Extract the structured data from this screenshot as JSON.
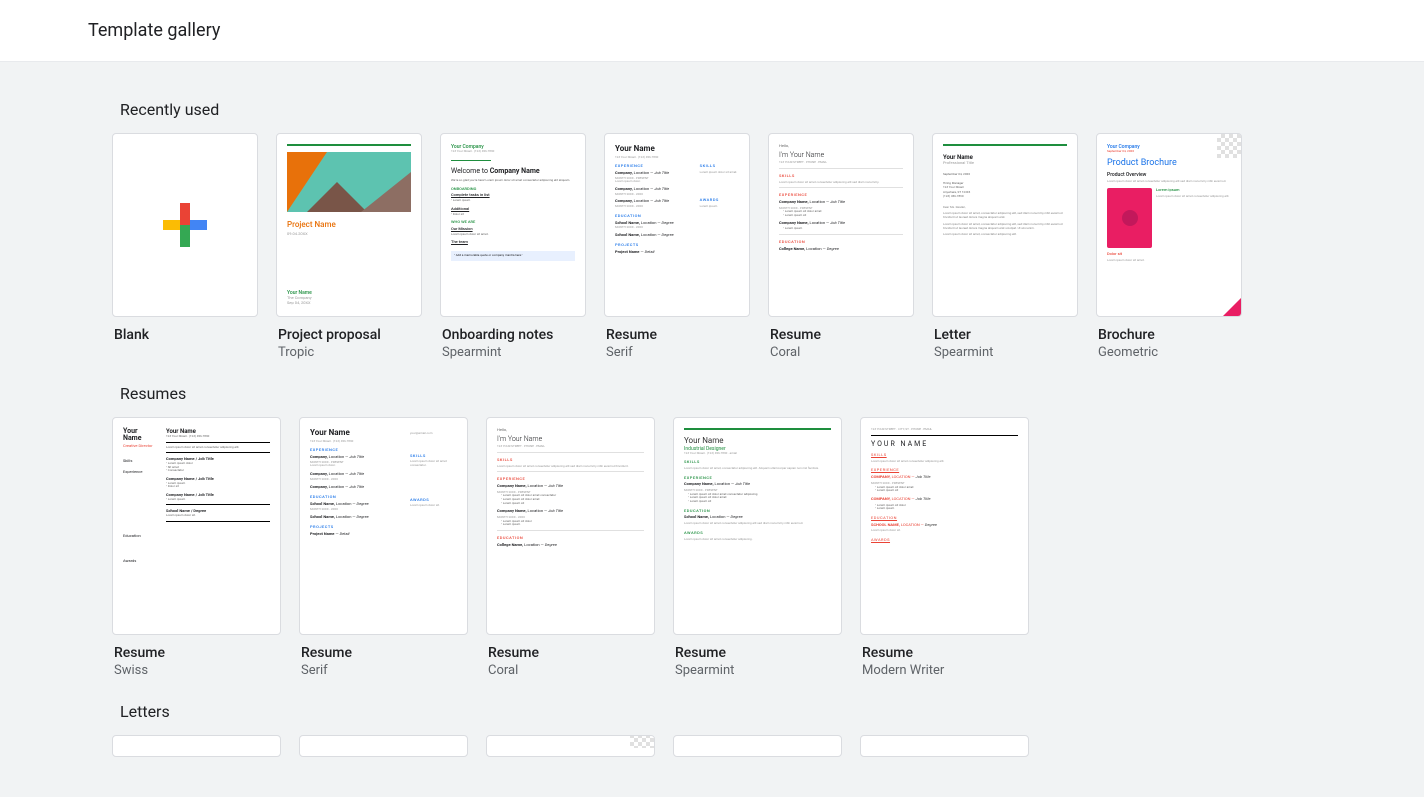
{
  "header": {
    "title": "Template gallery"
  },
  "sections": {
    "recent": {
      "title": "Recently used",
      "items": [
        {
          "title": "Blank",
          "subtitle": ""
        },
        {
          "title": "Project proposal",
          "subtitle": "Tropic"
        },
        {
          "title": "Onboarding notes",
          "subtitle": "Spearmint"
        },
        {
          "title": "Resume",
          "subtitle": "Serif"
        },
        {
          "title": "Resume",
          "subtitle": "Coral"
        },
        {
          "title": "Letter",
          "subtitle": "Spearmint"
        },
        {
          "title": "Brochure",
          "subtitle": "Geometric"
        }
      ]
    },
    "resumes": {
      "title": "Resumes",
      "items": [
        {
          "title": "Resume",
          "subtitle": "Swiss"
        },
        {
          "title": "Resume",
          "subtitle": "Serif"
        },
        {
          "title": "Resume",
          "subtitle": "Coral"
        },
        {
          "title": "Resume",
          "subtitle": "Spearmint"
        },
        {
          "title": "Resume",
          "subtitle": "Modern Writer"
        }
      ]
    },
    "letters": {
      "title": "Letters"
    }
  },
  "thumbs": {
    "project_proposal": {
      "heading": "Project Name",
      "footer_name": "Your Name",
      "footer_sub": "The Company"
    },
    "onboarding": {
      "company": "Your Company",
      "welcome_prefix": "Welcome to ",
      "welcome_bold": "Company Name",
      "sec1": "ONBOARDING",
      "sec2": "WHO WE ARE",
      "sec3": "Our Mission",
      "sec4": "The team"
    },
    "resume_serif": {
      "name": "Your Name",
      "sec_exp": "EXPERIENCE",
      "sec_edu": "EDUCATION",
      "sec_proj": "PROJECTS",
      "sec_skills": "SKILLS",
      "sec_awards": "AWARDS"
    },
    "resume_coral": {
      "hello": "Hello,",
      "name": "I'm Your Name",
      "sec_skills": "SKILLS",
      "sec_exp": "EXPERIENCE",
      "sec_edu": "EDUCATION"
    },
    "letter": {
      "name": "Your Name"
    },
    "brochure": {
      "company": "Your Company",
      "title": "Product Brochure",
      "overview": "Product Overview",
      "ipsum": "Lorem ipsum",
      "dolor": "Dolor sit"
    },
    "resume_swiss": {
      "name1": "Your",
      "name2": "Name",
      "role": "Creative Director",
      "l_skills": "Skills",
      "l_exp": "Experience",
      "l_edu": "Education",
      "l_awards": "Awards"
    },
    "resume_spearmint": {
      "name": "Your Name",
      "role": "Industrial Designer",
      "sec_skills": "SKILLS",
      "sec_exp": "EXPERIENCE",
      "sec_edu": "EDUCATION",
      "sec_awards": "AWARDS"
    },
    "resume_mw": {
      "name": "YOUR NAME",
      "sec_skills": "SKILLS",
      "sec_exp": "EXPERIENCE",
      "sec_edu": "EDUCATION",
      "sec_awards": "AWARDS"
    }
  }
}
